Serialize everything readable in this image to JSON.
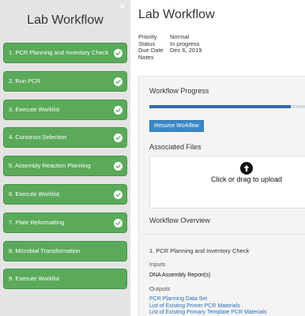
{
  "sidebar": {
    "close_glyph": "✕",
    "title": "Lab Workflow",
    "steps": [
      {
        "label": "1. PCR Planning and Inventory Check",
        "done": true
      },
      {
        "label": "2. Run PCR",
        "done": true
      },
      {
        "label": "3. Execute Worklist",
        "done": true
      },
      {
        "label": "4. Construct Selection",
        "done": true
      },
      {
        "label": "5. Assembly Reaction Planning",
        "done": true
      },
      {
        "label": "6. Execute Worklist",
        "done": true
      },
      {
        "label": "7. Plate Reformatting",
        "done": true
      },
      {
        "label": "8. Microbial Transformation",
        "done": false
      },
      {
        "label": "9. Execute Worklist",
        "done": false
      }
    ],
    "step_color": "#5aaa5a"
  },
  "main": {
    "title": "Lab Workflow",
    "meta": [
      {
        "key": "Priority",
        "value": "Normal"
      },
      {
        "key": "Status",
        "value": "In progress"
      },
      {
        "key": "Due Date",
        "value": "Dec 6, 2019"
      },
      {
        "key": "Notes",
        "value": ""
      }
    ],
    "progress": {
      "title": "Workflow Progress",
      "fraction": 0.85,
      "resume_label": "Resume Workflow"
    },
    "files": {
      "title": "Associated Files",
      "upload_text": "Click or drag to upload",
      "icon": "upload-arrow-icon"
    },
    "overview": {
      "title": "Workflow Overview",
      "step_title": "1. PCR Planning and Inventory Check",
      "inputs_label": "Inputs",
      "inputs": [
        "DNA Assembly Report(s)"
      ],
      "outputs_label": "Outputs",
      "outputs": [
        "PCR Planning Data Set",
        "List of Existing Primer PCR Materials",
        "List of Existing Primary Template PCR Materials"
      ]
    },
    "accent": "#3569a8",
    "button_color": "#3b88c8",
    "link_color": "#2a6ebd"
  }
}
